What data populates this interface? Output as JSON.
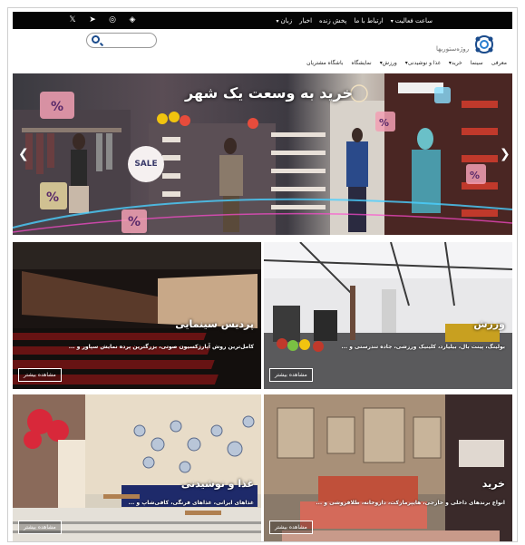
{
  "topbar": {
    "menu": [
      {
        "label": "ساعت فعالیت",
        "caret": true
      },
      {
        "label": "ارتباط با ما",
        "caret": false
      },
      {
        "label": "پخش زنده",
        "caret": false
      },
      {
        "label": "اخبار",
        "caret": false
      },
      {
        "label": "زبان",
        "caret": true
      }
    ],
    "social": [
      {
        "icon": "aparat-icon",
        "glyph": "◈"
      },
      {
        "icon": "instagram-icon",
        "glyph": "◎"
      },
      {
        "icon": "telegram-icon",
        "glyph": "➤"
      },
      {
        "icon": "twitter-icon",
        "glyph": "🐦"
      }
    ]
  },
  "header": {
    "search_placeholder": "",
    "logo_text": "روژه‌ستوریها"
  },
  "nav": [
    {
      "label": "معرفی",
      "caret": false
    },
    {
      "label": "سینما",
      "caret": false
    },
    {
      "label": "خرید",
      "caret": true
    },
    {
      "label": "غذا و نوشیدنی",
      "caret": true
    },
    {
      "label": "ورزش",
      "caret": true
    },
    {
      "label": "نمایشگاه",
      "caret": false
    },
    {
      "label": "باشگاه مشتریان",
      "caret": false
    }
  ],
  "hero": {
    "title": "خرید به وسعت یک شهر",
    "sale_label": "SALE",
    "percent_label": "%"
  },
  "cards": [
    {
      "title": "پردیس سینمایی",
      "desc": "کامل‌ترین روش آپارژکسیون صوتی، بزرگترین پرده نمایش سپاور و ...",
      "button": "مشاهده بیشتر"
    },
    {
      "title": "ورزش",
      "desc": "بولینگ، پینت بال، بیلیارد، کلینیک ورزشی، جاده تندرستی و ...",
      "button": "مشاهده بیشتر"
    },
    {
      "title": "غذا و نوشیدنی",
      "desc": "غذاهای ایرانی، غذاهای فرنگی، کافی‌شاپ و ...",
      "button": "مشاهده بیشتر"
    },
    {
      "title": "خرید",
      "desc": "انواع برندهای داخلی و خارجی، هایپرمارکت، داروخانه، طلافروشی و ...",
      "button": "مشاهده بیشتر"
    }
  ],
  "colors": {
    "topbar": "#050505",
    "brand_blue": "#1a4b8c",
    "sale_pink": "#f6a5b7"
  }
}
